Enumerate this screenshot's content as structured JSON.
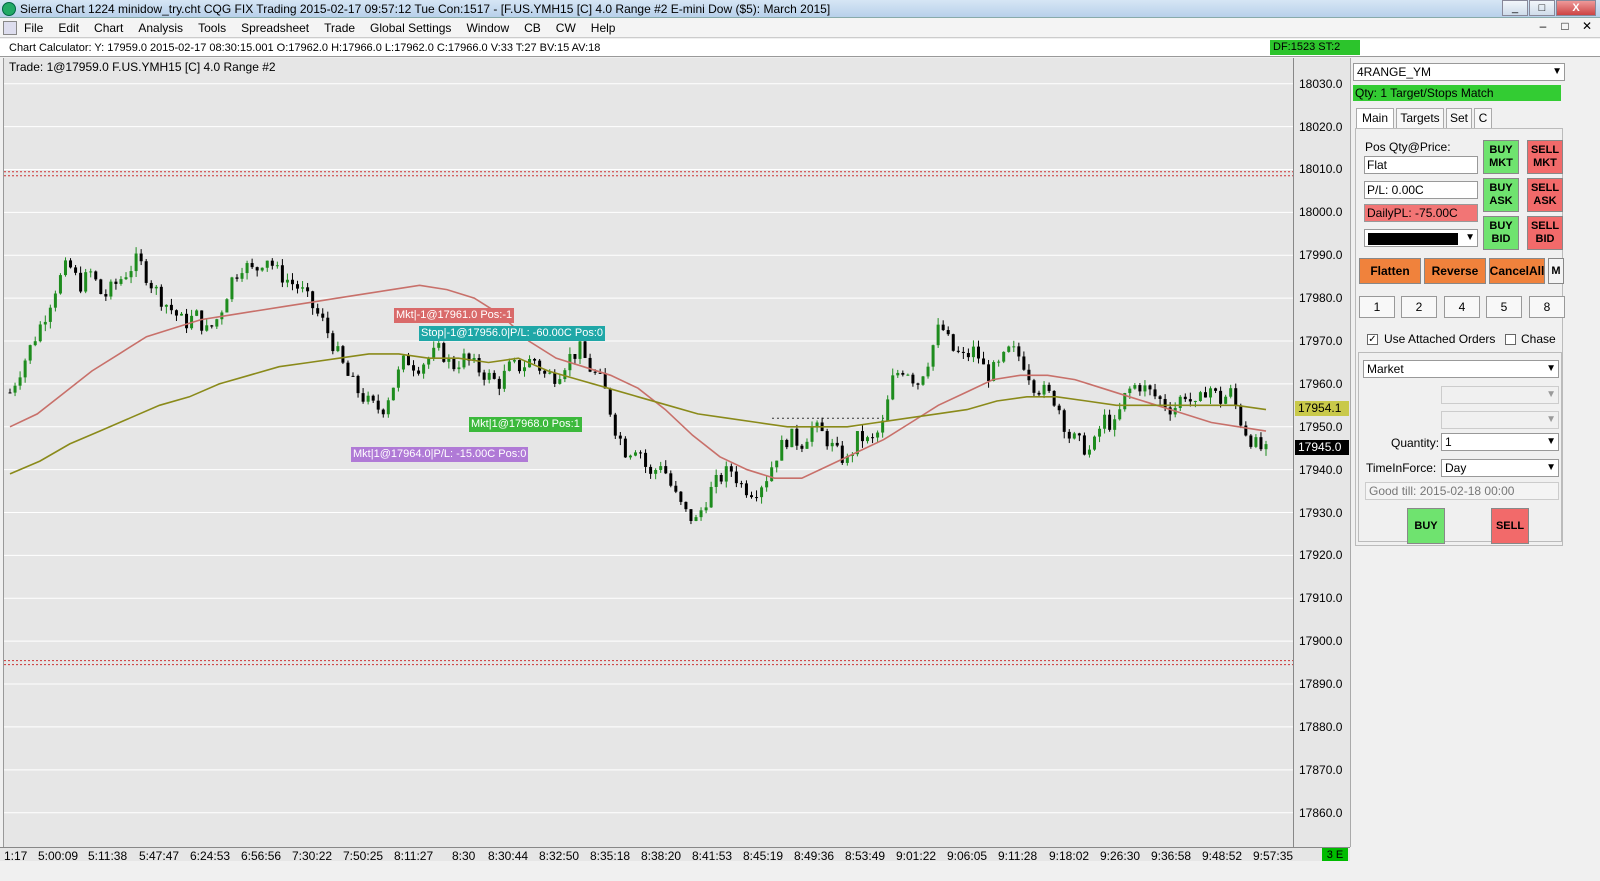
{
  "window": {
    "title": "Sierra Chart 1224 minidow_try.cht  CQG FIX Trading 2015-02-17  09:57:12 Tue  Con:1517 - [F.US.YMH15 [C]  4.0 Range  #2  E-mini Dow ($5): March 2015]",
    "minimize": "_",
    "maximize": "□",
    "close": "X"
  },
  "menu": {
    "items": [
      "File",
      "Edit",
      "Chart",
      "Analysis",
      "Tools",
      "Spreadsheet",
      "Trade",
      "Global Settings",
      "Window",
      "CB",
      "CW",
      "Help"
    ],
    "mdi_min": "–",
    "mdi_max": "□",
    "mdi_close": "✕"
  },
  "calculator": {
    "text": "Chart Calculator: Y: 17959.0  2015-02-17  08:30:15.001  O:17962.0  H:17966.0  L:17962.0  C:17966.0  V:33  T:27  BV:15  AV:18",
    "status": "DF:1523  ST:2"
  },
  "chart": {
    "trade_label": "Trade: 1@17959.0  F.US.YMH15 [C]  4.0 Range  #2",
    "annotations": [
      {
        "text": "Mkt|-1@17961.0 Pos:-1",
        "color": "#d96a6a"
      },
      {
        "text": "Stop|-1@17956.0|P/L: -60.00C Pos:0",
        "color": "#1fa7a7"
      },
      {
        "text": "Mkt|1@17968.0 Pos:1",
        "color": "#3cb93c"
      },
      {
        "text": "Mkt|1@17964.0|P/L: -15.00C Pos:0",
        "color": "#b07ad6"
      }
    ],
    "colors": {
      "up": "#1e8c1e",
      "down": "#000000",
      "ma_fast": "#c8706a",
      "ma_slow": "#8a8a1a",
      "bg": "#e6e6e6",
      "level": "#cc3333"
    }
  },
  "chart_data": {
    "type": "candlestick",
    "title": "F.US.YMH15 [C] 4.0 Range #2",
    "ylim": [
      17852,
      18036
    ],
    "y_ticks": [
      "18030.0",
      "18020.0",
      "18010.0",
      "18000.0",
      "17990.0",
      "17980.0",
      "17970.0",
      "17960.0",
      "17950.0",
      "17940.0",
      "17930.0",
      "17920.0",
      "17910.0",
      "17900.0",
      "17890.0",
      "17880.0",
      "17870.0",
      "17860.0"
    ],
    "x_ticks": [
      "1:17",
      "5:00:09",
      "5:11:38",
      "5:47:47",
      "6:24:53",
      "6:56:56",
      "7:30:22",
      "7:50:25",
      "8:11:27",
      "8:30",
      "8:30:44",
      "8:32:50",
      "8:35:18",
      "8:38:20",
      "8:41:53",
      "8:45:19",
      "8:49:36",
      "8:53:49",
      "9:01:22",
      "9:06:05",
      "9:11:28",
      "9:18:02",
      "9:26:30",
      "9:36:58",
      "9:48:52",
      "9:57:35"
    ],
    "price_path": [
      17958,
      17964,
      17970,
      17976,
      17983,
      17988,
      17983,
      17986,
      17980,
      17983,
      17986,
      17989,
      17984,
      17980,
      17977,
      17974,
      17976,
      17972,
      17976,
      17984,
      17988,
      17986,
      17990,
      17986,
      17984,
      17982,
      17978,
      17974,
      17968,
      17962,
      17958,
      17955,
      17954,
      17960,
      17966,
      17964,
      17966,
      17968,
      17964,
      17966,
      17964,
      17962,
      17960,
      17964,
      17964,
      17966,
      17962,
      17962,
      17966,
      17968,
      17963,
      17960,
      17950,
      17944,
      17946,
      17938,
      17942,
      17935,
      17930,
      17928,
      17934,
      17938,
      17940,
      17936,
      17935,
      17938,
      17944,
      17948,
      17946,
      17950,
      17948,
      17944,
      17942,
      17948,
      17946,
      17950,
      17962,
      17964,
      17960,
      17966,
      17974,
      17968,
      17966,
      17968,
      17962,
      17964,
      17968,
      17966,
      17960,
      17958,
      17956,
      17948,
      17946,
      17944,
      17952,
      17950,
      17958,
      17960,
      17958,
      17956,
      17954,
      17958,
      17954,
      17960,
      17956,
      17958,
      17950,
      17946,
      17944
    ],
    "ma_fast": [
      17950,
      17953,
      17958,
      17963,
      17967,
      17971,
      17973,
      17975,
      17976,
      17977,
      17978,
      17979,
      17980,
      17981,
      17982,
      17983,
      17982,
      17980,
      17976,
      17970,
      17966,
      17964,
      17962,
      17959,
      17954,
      17948,
      17943,
      17940,
      17938,
      17938,
      17941,
      17944,
      17947,
      17951,
      17955,
      17958,
      17961,
      17962,
      17962,
      17961,
      17959,
      17957,
      17955,
      17953,
      17951,
      17950,
      17949
    ],
    "ma_slow": [
      17939,
      17942,
      17946,
      17949,
      17952,
      17955,
      17957,
      17960,
      17962,
      17964,
      17965,
      17966,
      17967,
      17967,
      17966,
      17966,
      17965,
      17966,
      17963,
      17961,
      17959,
      17957,
      17955,
      17953,
      17952,
      17951,
      17950,
      17950,
      17950,
      17951,
      17952,
      17953,
      17954,
      17956,
      17957,
      17957,
      17956,
      17955,
      17955,
      17955,
      17955,
      17955,
      17954
    ],
    "levels": [
      18009,
      17895
    ],
    "current_price": "17945.0",
    "ma_label": "17954.1"
  },
  "panel": {
    "symbol": "4RANGE_YM",
    "qty_status": "Qty: 1 Target/Stops Match",
    "tabs": [
      "Main",
      "Targets",
      "Set",
      "C"
    ],
    "pos_label": "Pos Qty@Price:",
    "pos_value": "Flat",
    "pl_value": "P/L: 0.00C",
    "daily_pl": "DailyPL: -75.00C",
    "buy_mkt": "BUY MKT",
    "sell_mkt": "SELL MKT",
    "buy_ask": "BUY ASK",
    "sell_ask": "SELL ASK",
    "buy_bid": "BUY BID",
    "sell_bid": "SELL BID",
    "flatten": "Flatten",
    "reverse": "Reverse",
    "cancel_all": "CancelAll",
    "m": "M",
    "qty_buttons": [
      "1",
      "2",
      "4",
      "5",
      "8"
    ],
    "use_attached": "Use Attached Orders",
    "chase": "Chase",
    "order_type": "Market",
    "quantity_label": "Quantity:",
    "quantity_value": "1",
    "tif_label": "TimeInForce:",
    "tif_value": "Day",
    "good_till": "Good till: 2015-02-18 00:00",
    "buy": "BUY",
    "sell": "SELL"
  },
  "xaxis_badge": "3 E"
}
